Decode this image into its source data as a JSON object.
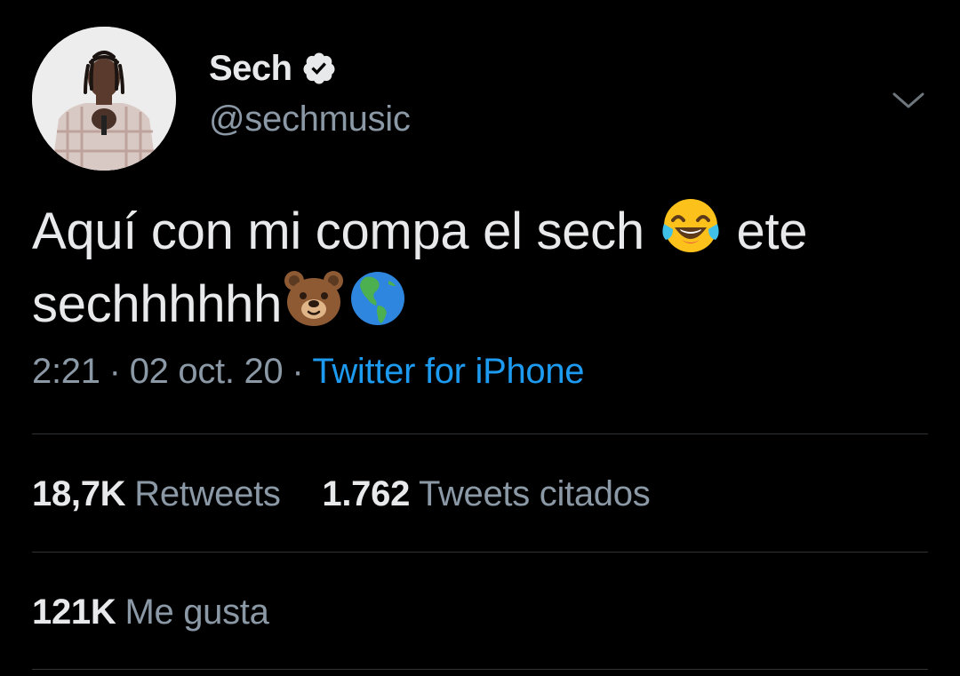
{
  "tweet": {
    "author": {
      "display_name": "Sech",
      "handle": "@sechmusic",
      "verified": true,
      "avatar_icon": "avatar-photo"
    },
    "text": {
      "line1_part1": "Aquí con mi compa el sech",
      "line1_emoji": "face-with-tears-of-joy",
      "line1_part2": "ete",
      "line2_part1": "sechhhhhh",
      "line2_emoji1": "bear-face",
      "line2_emoji2": "globe-showing-americas"
    },
    "meta": {
      "time": "2:21",
      "separator": "·",
      "date": "02 oct. 20",
      "source": "Twitter for iPhone"
    },
    "stats": {
      "retweets_count": "18,7K",
      "retweets_label": "Retweets",
      "quotes_count": "1.762",
      "quotes_label": "Tweets citados",
      "likes_count": "121K",
      "likes_label": "Me gusta"
    },
    "colors": {
      "background": "#000000",
      "primary_text": "#e7e9ea",
      "secondary_text": "#8b98a5",
      "link": "#1d9bf0",
      "divider": "#2f3336"
    }
  }
}
